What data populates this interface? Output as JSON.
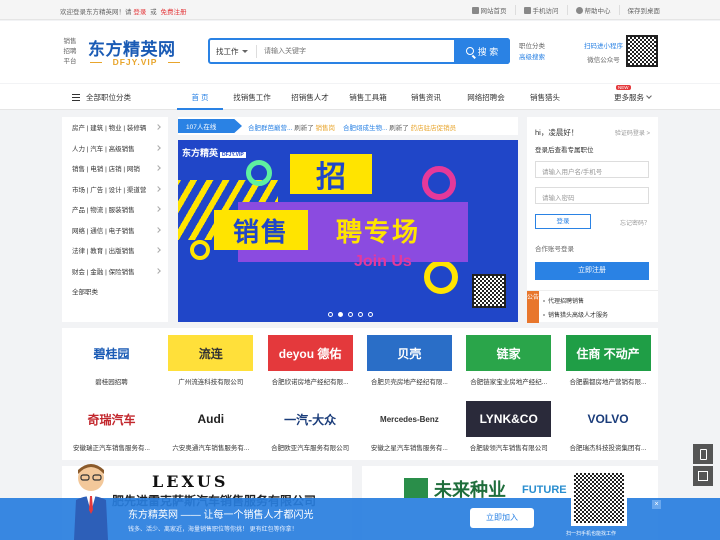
{
  "topbar": {
    "welcome": "欢迎登录东方精英网！请",
    "login": "登录",
    "or": "或",
    "register": "免费注册",
    "links": [
      "网站首页",
      "手机访问",
      "帮助中心",
      "保存到桌面"
    ]
  },
  "header": {
    "logo_side": [
      "销售",
      "招聘",
      "平台"
    ],
    "logo_brand": "东方精英网",
    "logo_domain": "DFJY.VIP",
    "search_category": "找工作",
    "search_placeholder": "请输入关键字",
    "search_button": "搜 索",
    "hot_links": [
      "职位分类",
      "高级搜索"
    ],
    "mini_program": "扫码进小程序",
    "wechat": "微信公众号"
  },
  "nav": {
    "all_categories": "全部职位分类",
    "items": [
      "首 页",
      "找销售工作",
      "招销售人才",
      "销售工具箱",
      "销售资讯",
      "网络招聘会",
      "销售猎头"
    ],
    "more": "更多服务",
    "new_badge": "NEW"
  },
  "categories": [
    "房产 | 建筑 | 物业 | 装修辆",
    "人力 | 汽车 | 高级销售",
    "销售 | 电销 | 店销 | 网销",
    "市场 | 广告 | 设计 | 渠道营",
    "产品 | 物流 | 服装销售",
    "网络 | 通信 | 电子销售",
    "法律 | 教育 | 出版销售",
    "财会 | 金融 | 保险销售",
    "全部职类"
  ],
  "ticker": {
    "online": "107人在线",
    "items": [
      {
        "company": "合肥群芭巅营...",
        "action": "刷新了",
        "job": "销售岗"
      },
      {
        "company": "合肥翊成生物...",
        "action": "刷新了",
        "job": "药店驻店促销员"
      }
    ]
  },
  "banner": {
    "logo": "东方精英",
    "logo_tag": "DFJY.VIP",
    "zhao": "招",
    "xiaoshou": "销售",
    "zhuanchang": "聘专场",
    "join": "Join Us"
  },
  "login": {
    "greeting": "hi，凌晨好！",
    "sms_login": "验证码登录",
    "tip": "登录后查看专属职位",
    "username_placeholder": "请输入用户名/手机号",
    "password_placeholder": "请输入密码",
    "login_button": "登录",
    "forgot": "忘记密码？",
    "other_login": "合作账号登录",
    "register_button": "立即注册",
    "notice_tag": "公告",
    "notices": [
      "代理招聘销售",
      "销售猎头高级人才服务"
    ]
  },
  "companies": [
    {
      "logo": "碧桂园",
      "name": "碧桂园招聘",
      "color": "#1a5bb5",
      "bg": "#ffffff"
    },
    {
      "logo": "流连",
      "name": "广州流连科技有限公司",
      "color": "#333333",
      "bg": "#ffe03a"
    },
    {
      "logo": "deyou 德佑",
      "name": "合肥欣诺房地产经纪有限...",
      "color": "#ffffff",
      "bg": "#e4393c"
    },
    {
      "logo": "贝壳",
      "name": "合肥贝壳房地产经纪有限...",
      "color": "#ffffff",
      "bg": "#2a6ec7"
    },
    {
      "logo": "链家",
      "name": "合肥链家宝业房地产经纪...",
      "color": "#ffffff",
      "bg": "#2aa54a"
    },
    {
      "logo": "住商 不动产",
      "name": "合肥霸都房地产营销有限...",
      "color": "#ffffff",
      "bg": "#1f9e46"
    },
    {
      "logo": "奇瑞汽车",
      "name": "安徽瑞正汽车销售服务有...",
      "color": "#c2272d",
      "bg": "#ffffff"
    },
    {
      "logo": "Audi",
      "name": "六安奥通汽车销售服务有...",
      "color": "#222222",
      "bg": "#ffffff"
    },
    {
      "logo": "一汽-大众",
      "name": "合肥欧亚汽车服务有限公司",
      "color": "#1a3c7a",
      "bg": "#ffffff"
    },
    {
      "logo": "Mercedes-Benz",
      "name": "安徽之星汽车销售服务有...",
      "color": "#333333",
      "bg": "#ffffff"
    },
    {
      "logo": "LYNK&CO",
      "name": "合肥骏领汽车销售有限公司",
      "color": "#ffffff",
      "bg": "#2a2a3a"
    },
    {
      "logo": "VOLVO",
      "name": "合肥瑞杰科技投资集团有...",
      "color": "#1a3c7a",
      "bg": "#ffffff"
    }
  ],
  "ads": {
    "ad1_brand": "LEXUS",
    "ad1_text": "肥先进雷克萨斯汽车销售服务有限公司",
    "ad2_text": "未来种业",
    "ad2_en": "FUTURE"
  },
  "bottombar": {
    "title": "东方精英网 —— 让每一个销售人才都闪光",
    "sub": "钱多、活少、离家近，海量销售职位等你挑！ 更有红包等你拿！",
    "join_button": "立即加入",
    "qr_text": "扫一扫手机也能找工作",
    "close": "×"
  }
}
